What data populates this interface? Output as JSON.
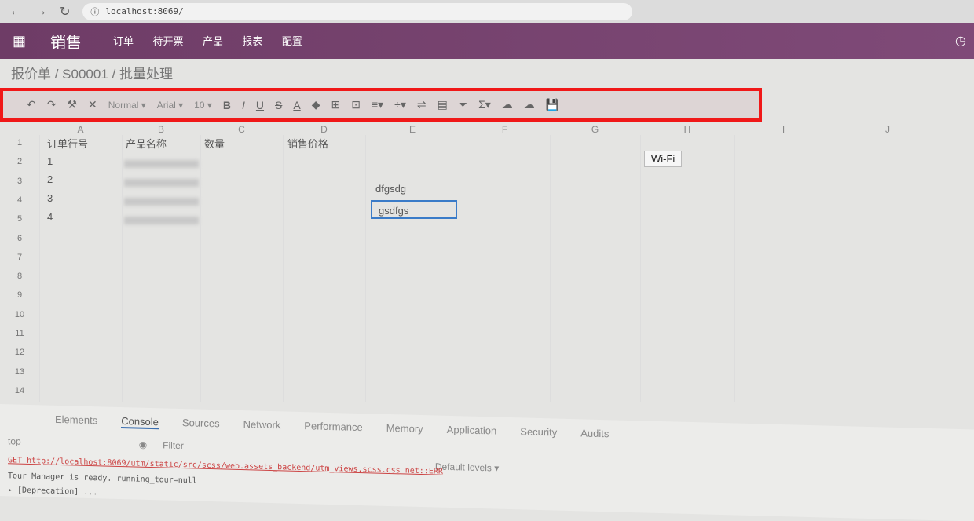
{
  "browser": {
    "url": "localhost:8069/"
  },
  "nav": {
    "brand": "销售",
    "menu": [
      "订单",
      "待开票",
      "产品",
      "报表",
      "配置"
    ]
  },
  "breadcrumb": "报价单 / S00001 / 批量处理",
  "toolbar": {
    "style": "Normal",
    "font": "Arial",
    "size": "10",
    "highlight_color": "#f01818"
  },
  "sheet": {
    "columns": [
      "A",
      "B",
      "C",
      "D",
      "E",
      "F",
      "G",
      "H",
      "I",
      "J"
    ],
    "rows": [
      "1",
      "2",
      "3",
      "4",
      "5",
      "6",
      "7",
      "8",
      "9",
      "10",
      "11",
      "12",
      "13",
      "14"
    ],
    "header": [
      "订单行号",
      "产品名称",
      "数量",
      "销售价格"
    ],
    "line_numbers": [
      "1",
      "2",
      "3",
      "4"
    ],
    "e4": "dfgsdg",
    "e5": "gsdfgs"
  },
  "tooltip": "Wi-Fi",
  "devtools": {
    "tabs": [
      "Elements",
      "Console",
      "Sources",
      "Network",
      "Performance",
      "Memory",
      "Application",
      "Security",
      "Audits"
    ],
    "context": "top",
    "filter": "Filter",
    "levels": "Default levels ▾",
    "logs": [
      "GET http://localhost:8069/utm/static/src/scss/web.assets_backend/utm_views.scss.css net::ERR",
      "Tour Manager is ready.  running_tour=null",
      "▸ [Deprecation] ..."
    ]
  }
}
